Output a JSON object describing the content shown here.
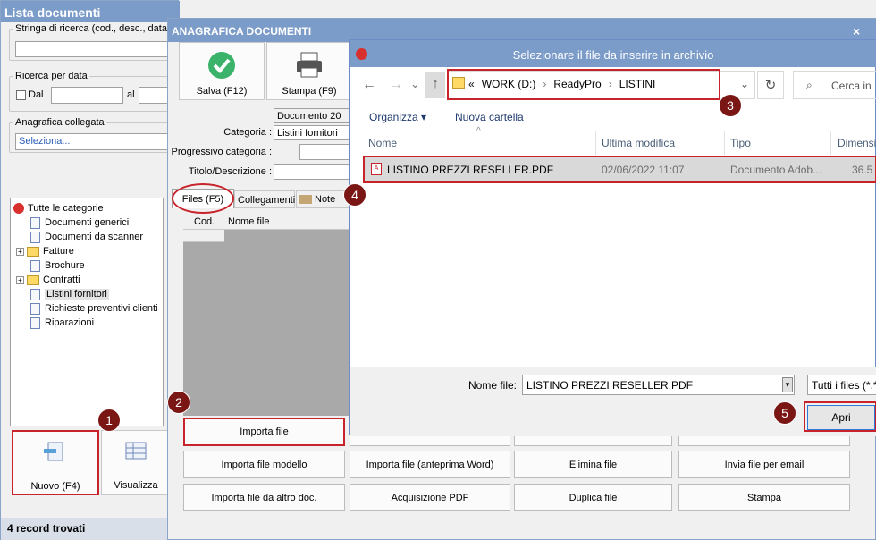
{
  "win1": {
    "title": "Lista documenti",
    "search_label": "Stringa di ricerca (cod., desc., data",
    "date_group": "Ricerca per data",
    "dal_label": "Dal",
    "al_label": "al",
    "linked_group": "Anagrafica collegata",
    "linked_value": "Seleziona...",
    "tree": [
      "Tutte le categorie",
      "Documenti generici",
      "Documenti da scanner",
      "Fatture",
      "Brochure",
      "Contratti",
      "Listini fornitori",
      "Richieste preventivi clienti",
      "Riparazioni"
    ],
    "new_btn": "Nuovo (F4)",
    "view_btn": "Visualizza",
    "status": "4 record trovati"
  },
  "win2": {
    "title": "ANAGRAFICA DOCUMENTI",
    "save_btn": "Salva (F12)",
    "print_btn": "Stampa (F9)",
    "doc_number": "Documento 20",
    "categoria_label": "Categoria :",
    "categoria_value": "Listini fornitori",
    "progressivo_label": "Progressivo categoria :",
    "titolo_label": "Titolo/Descrizione :",
    "tabs": [
      "Files (F5)",
      "Collegamenti",
      "Note"
    ],
    "cols": [
      "Cod.",
      "Nome file"
    ],
    "actions": [
      "Importa file",
      "Importa file modello",
      "Importa file (anteprima Word)",
      "Elimina file",
      "Invia file per email",
      "Importa file da altro doc.",
      "Acquisizione PDF",
      "Duplica file",
      "Stampa"
    ]
  },
  "dialog": {
    "title": "Selezionare il file da inserire in archivio",
    "path": [
      "WORK (D:)",
      "ReadyPro",
      "LISTINI"
    ],
    "search_placeholder": "Cerca in",
    "organizza": "Organizza",
    "nuova_cartella": "Nuova cartella",
    "headers": [
      "Nome",
      "Ultima modifica",
      "Tipo",
      "Dimensi"
    ],
    "file": {
      "name": "LISTINO PREZZI RESELLER.PDF",
      "date": "02/06/2022 11:07",
      "type": "Documento Adob...",
      "size": "36.5"
    },
    "filename_label": "Nome file:",
    "filename_value": "LISTINO PREZZI RESELLER.PDF",
    "filetype_value": "Tutti i files (*.*",
    "open_btn": "Apri"
  },
  "callouts": [
    "1",
    "2",
    "3",
    "4",
    "5"
  ],
  "colors": {
    "titlebar": "#7b9bc9",
    "callout": "#7a1715",
    "highlight": "#c8222a",
    "accent": "#2b5fb8"
  }
}
